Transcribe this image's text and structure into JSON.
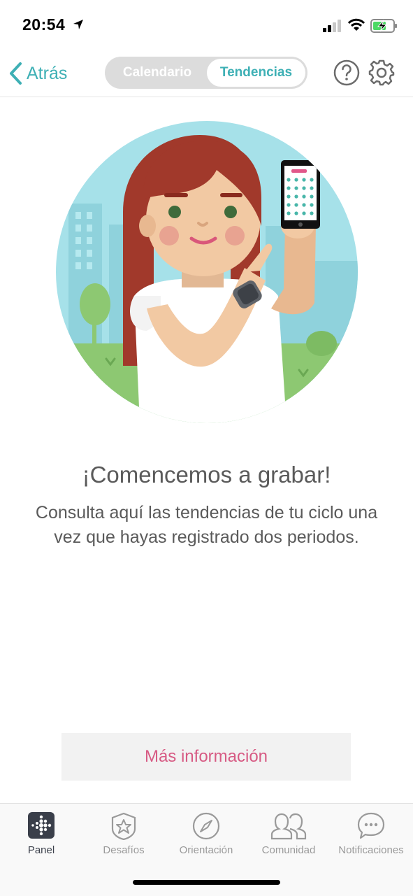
{
  "status_bar": {
    "time": "20:54"
  },
  "nav": {
    "back_label": "Atrás",
    "segments": {
      "calendar": "Calendario",
      "trends": "Tendencias"
    },
    "selected_segment": "Tendencias"
  },
  "content": {
    "headline": "¡Comencemos a grabar!",
    "body": "Consulta aquí las tendencias de tu ciclo una vez que hayas registrado dos periodos.",
    "more_button": "Más información"
  },
  "tabs": [
    {
      "label": "Panel",
      "icon": "fitbit-dots-icon",
      "active": true
    },
    {
      "label": "Desafíos",
      "icon": "star-badge-icon",
      "active": false
    },
    {
      "label": "Orientación",
      "icon": "compass-icon",
      "active": false
    },
    {
      "label": "Comunidad",
      "icon": "people-icon",
      "active": false
    },
    {
      "label": "Notificaciones",
      "icon": "chat-bubble-icon",
      "active": false
    }
  ],
  "colors": {
    "accent": "#3eb0b5",
    "pink": "#d75b84",
    "sky": "#a6e1e9",
    "grass": "#8dc872",
    "hair": "#a1392b"
  }
}
